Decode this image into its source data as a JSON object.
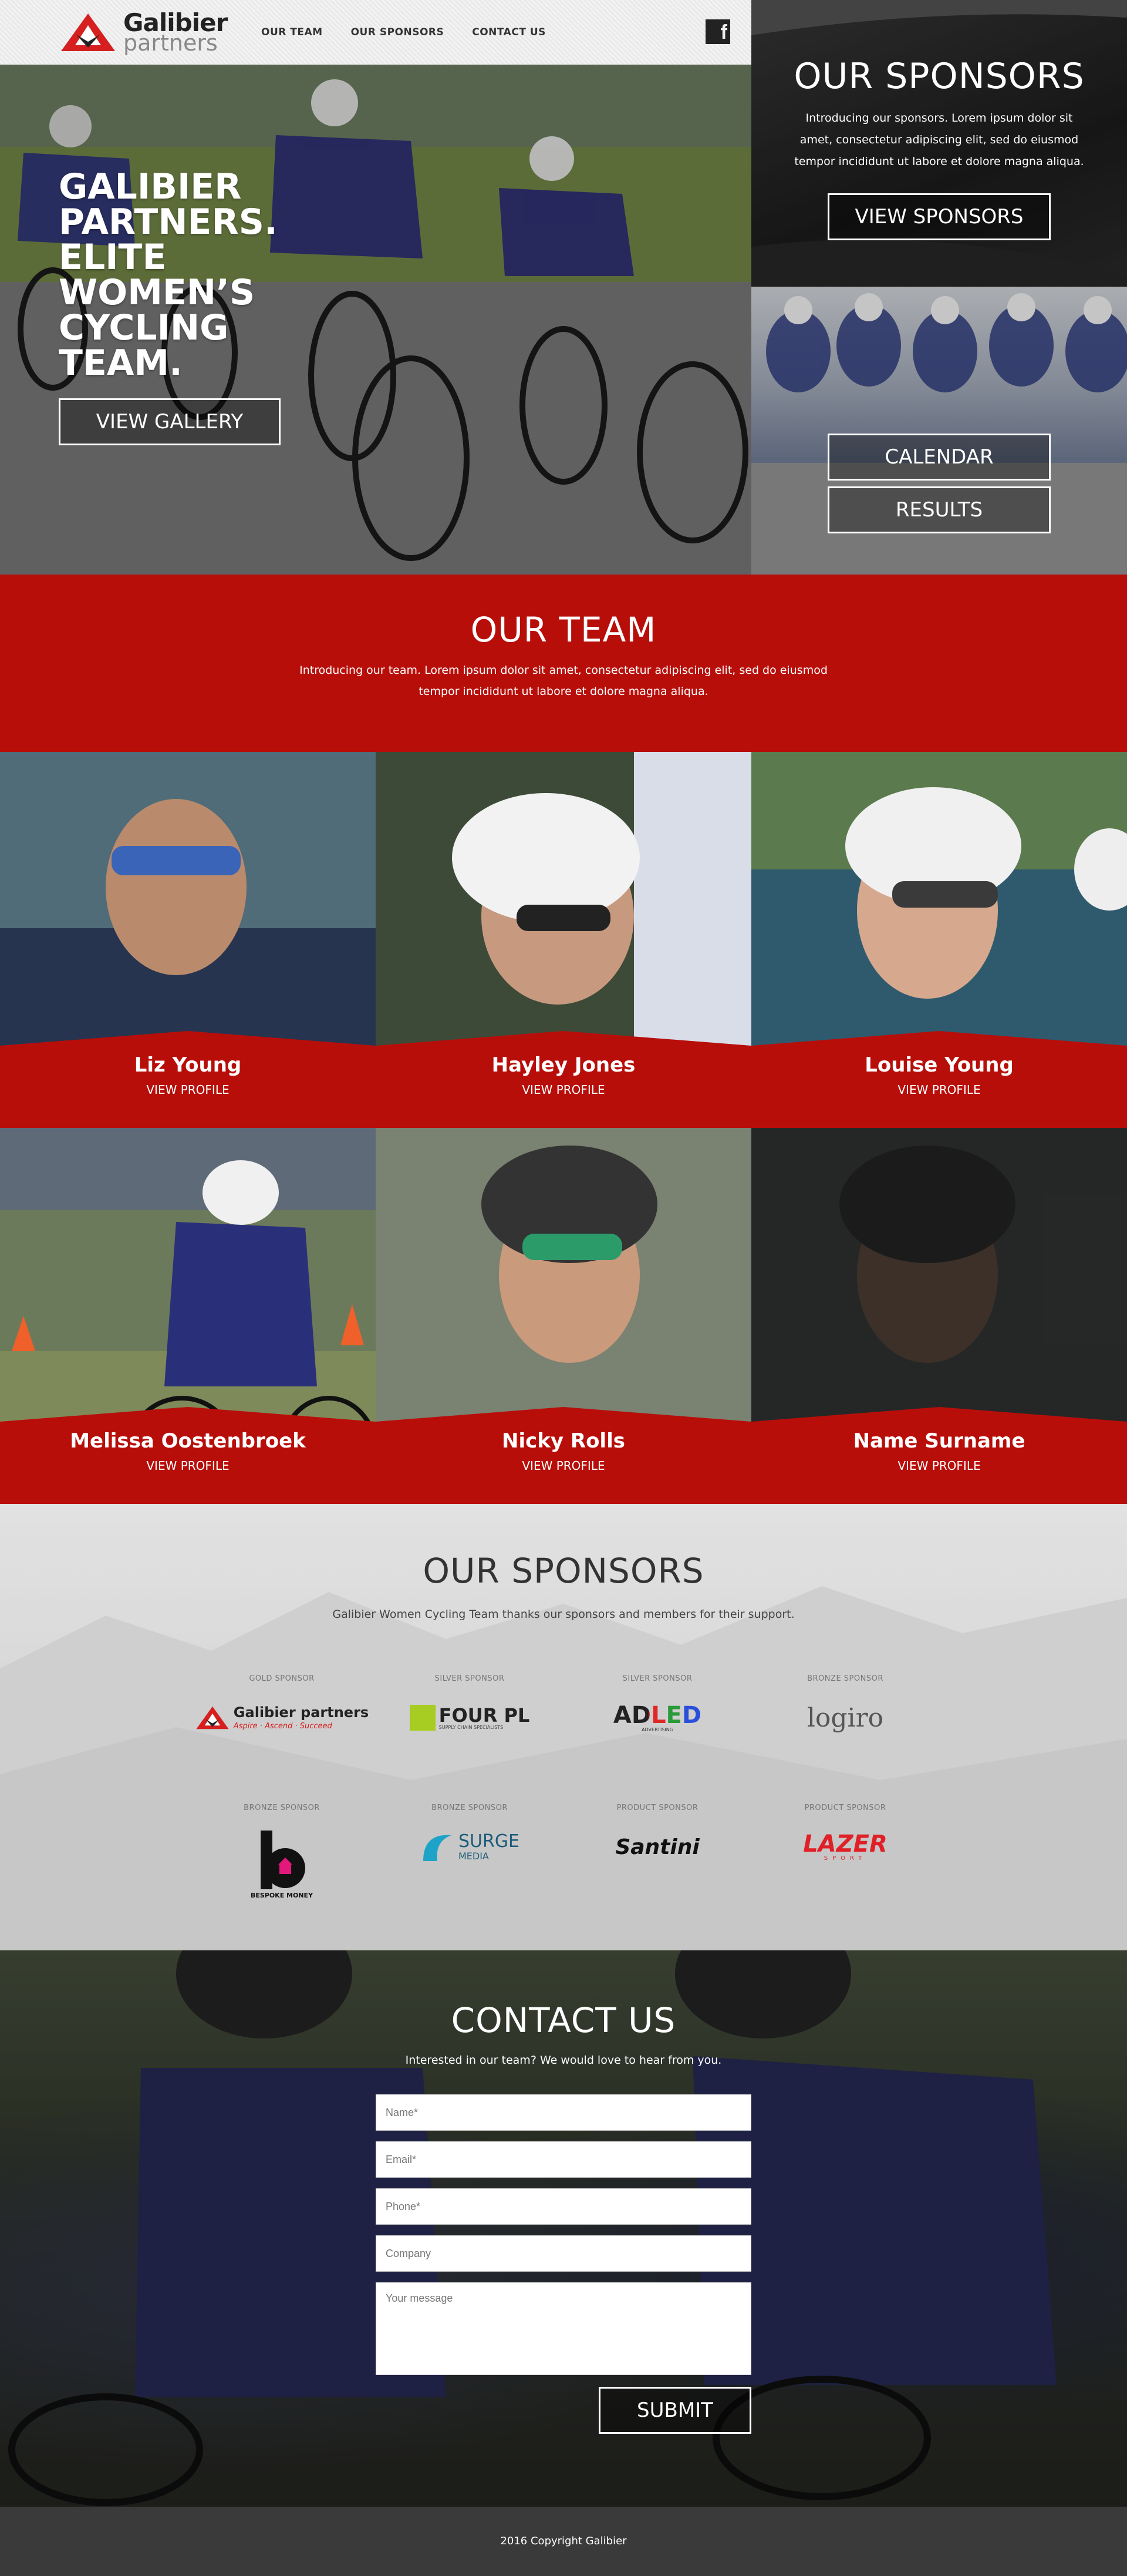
{
  "nav": {
    "logo_name": "Galibier",
    "logo_sub": "partners",
    "items": [
      "OUR TEAM",
      "OUR SPONSORS",
      "CONTACT US"
    ],
    "social_icon": "facebook-icon"
  },
  "hero": {
    "title_lines": [
      "GALIBIER",
      "PARTNERS.",
      "ELITE",
      "WOMEN’S",
      "CYCLING",
      "TEAM."
    ],
    "gallery_button": "VIEW GALLERY"
  },
  "sponsors_panel": {
    "title": "OUR SPONSORS",
    "text": "Introducing our sponsors. Lorem ipsum dolor sit amet, consectetur adipiscing elit, sed do eiusmod tempor incididunt ut labore et dolore magna aliqua.",
    "button": "VIEW SPONSORS"
  },
  "schedule_panel": {
    "calendar_button": "CALENDAR",
    "results_button": "RESULTS"
  },
  "team": {
    "title": "OUR TEAM",
    "text": "Introducing our team. Lorem ipsum dolor sit amet, consectetur adipiscing elit, sed do eiusmod tempor incididunt ut labore et dolore magna aliqua.",
    "members": [
      {
        "name": "Liz Young",
        "link": "VIEW PROFILE"
      },
      {
        "name": "Hayley Jones",
        "link": "VIEW PROFILE"
      },
      {
        "name": "Louise Young",
        "link": "VIEW PROFILE"
      },
      {
        "name": "Melissa Oostenbroek",
        "link": "VIEW PROFILE"
      },
      {
        "name": "Nicky Rolls",
        "link": "VIEW PROFILE"
      },
      {
        "name": "Name Surname",
        "link": "VIEW PROFILE"
      }
    ]
  },
  "sponsors": {
    "title": "OUR SPONSORS",
    "subtitle": "Galibier Women Cycling Team thanks our sponsors and members for their support.",
    "list": [
      {
        "tier": "GOLD SPONSOR",
        "name": "Galibier partners",
        "tagline": "Aspire · Ascend · Succeed"
      },
      {
        "tier": "SILVER SPONSOR",
        "name": "FOUR PL",
        "tagline": "SUPPLY CHAIN SPECIALISTS"
      },
      {
        "tier": "SILVER SPONSOR",
        "name": "ADLED",
        "tagline": "ADVERTISING"
      },
      {
        "tier": "BRONZE SPONSOR",
        "name": "logiro",
        "tagline": ""
      },
      {
        "tier": "BRONZE SPONSOR",
        "name": "BESPOKE MONEY",
        "tagline": ""
      },
      {
        "tier": "BRONZE SPONSOR",
        "name": "SURGE",
        "tagline": "MEDIA"
      },
      {
        "tier": "PRODUCT SPONSOR",
        "name": "Santini",
        "tagline": ""
      },
      {
        "tier": "PRODUCT SPONSOR",
        "name": "LAZER",
        "tagline": "SPORT"
      }
    ]
  },
  "contact": {
    "title": "CONTACT US",
    "subtitle": "Interested in our team? We would love to hear from you.",
    "name_placeholder": "Name*",
    "email_placeholder": "Email*",
    "phone_placeholder": "Phone*",
    "company_placeholder": "Company",
    "message_placeholder": "Your message",
    "submit": "SUBMIT"
  },
  "footer": {
    "copyright": "2016 Copyright Galibier"
  },
  "colors": {
    "brand_red": "#b80e0a",
    "dark": "#3a3a3a"
  }
}
